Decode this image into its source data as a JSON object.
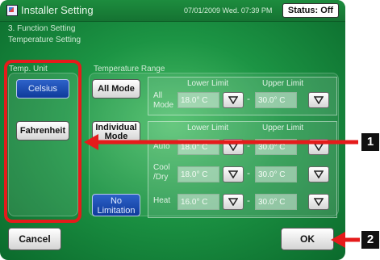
{
  "header": {
    "title": "Installer Setting",
    "datetime": "07/01/2009 Wed. 07:39 PM",
    "status": "Status: Off"
  },
  "breadcrumb": {
    "section": "3. Function Setting",
    "page": "Temperature Setting"
  },
  "temp_unit": {
    "label": "Temp. Unit",
    "celsius": "Celsius",
    "fahrenheit": "Fahrenheit",
    "selected": "Celsius"
  },
  "temperature_range": {
    "label": "Temperature Range",
    "all_mode_button": "All Mode",
    "individual_mode_button": "Individual Mode",
    "no_limitation_button": "No Limitation",
    "lower_limit": "Lower Limit",
    "upper_limit": "Upper Limit",
    "all_mode": {
      "label": "All Mode",
      "lower": "18.0° C",
      "upper": "30.0° C"
    },
    "individual": [
      {
        "label": "Auto",
        "lower": "18.0° C",
        "upper": "30.0° C"
      },
      {
        "label": "Cool /Dry",
        "lower": "18.0° C",
        "upper": "30.0° C"
      },
      {
        "label": "Heat",
        "lower": "16.0° C",
        "upper": "30.0° C"
      }
    ]
  },
  "footer": {
    "cancel": "Cancel",
    "ok": "OK"
  },
  "callouts": {
    "one": "1",
    "two": "2"
  },
  "colors": {
    "background": "#1c9444",
    "callout": "#e51b1b",
    "selected_button": "#2d62c9"
  }
}
